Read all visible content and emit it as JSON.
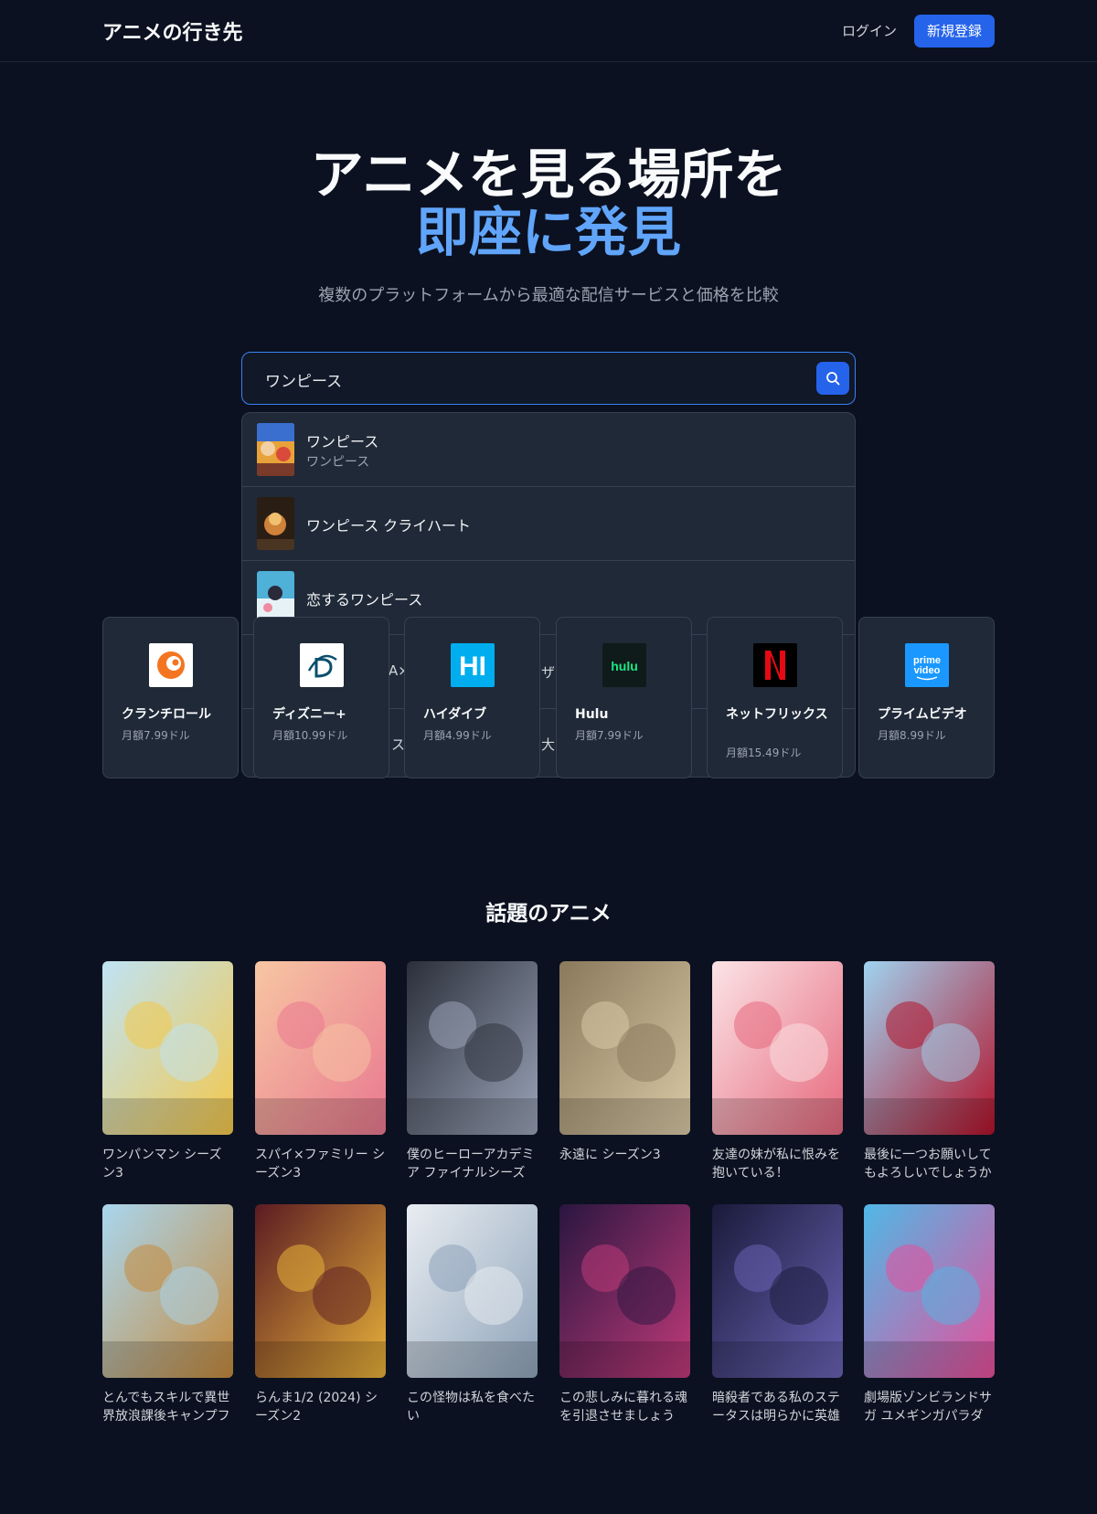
{
  "header": {
    "brand": "アニメの行き先",
    "login": "ログイン",
    "signup": "新規登録"
  },
  "hero": {
    "line1": "アニメを見る場所を",
    "line2": "即座に発見",
    "subtitle": "複数のプラットフォームから最適な配信サービスと価格を比較"
  },
  "search": {
    "value": "ワンピース",
    "results": [
      {
        "title": "ワンピース",
        "subtitle": "ワンピース"
      },
      {
        "title": "ワンピース クライハート"
      },
      {
        "title": "恋するワンピース"
      }
    ],
    "hidden_fragments": [
      "A×",
      "ザン",
      "ス",
      "大"
    ]
  },
  "services": [
    {
      "name": "クランチロール",
      "price": "月額7.99ドル",
      "logo": "crunchyroll-logo",
      "color": "#f47521"
    },
    {
      "name": "ディズニー+",
      "price": "月額10.99ドル",
      "logo": "disney-plus-logo",
      "color": "#0b4f6c"
    },
    {
      "name": "ハイダイブ",
      "price": "月額4.99ドル",
      "logo": "hidive-logo",
      "color": "#00aeef"
    },
    {
      "name": "Hulu",
      "price": "月額7.99ドル",
      "logo": "hulu-logo",
      "color": "#1ce783"
    },
    {
      "name": "ネットフリックス",
      "price": "月額15.49ドル",
      "logo": "netflix-logo",
      "color": "#e50914"
    },
    {
      "name": "プライムビデオ",
      "price": "月額8.99ドル",
      "logo": "prime-video-logo",
      "color": "#1a98ff"
    }
  ],
  "logo_text": {
    "hidive": "HI",
    "hulu": "hulu",
    "prime1": "prime",
    "prime2": "video"
  },
  "trending": {
    "title": "話題のアニメ",
    "items": [
      {
        "title": "ワンパンマン シーズン3",
        "colors": [
          "#bfe3f5",
          "#f3c84b"
        ]
      },
      {
        "title": "スパイ×ファミリー シーズン3",
        "colors": [
          "#f7c6a3",
          "#e9788f"
        ]
      },
      {
        "title": "僕のヒーローアカデミア ファイナルシーズン",
        "colors": [
          "#2b2f3a",
          "#9aa4b8"
        ]
      },
      {
        "title": "永遠に シーズン3",
        "colors": [
          "#8a7a5c",
          "#d9c9a6"
        ]
      },
      {
        "title": "友達の妹が私に恨みを抱いている！",
        "colors": [
          "#fbe4e6",
          "#e6687d"
        ]
      },
      {
        "title": "最後に一つお願いしてもよろしいでしょうか",
        "colors": [
          "#9fd3f0",
          "#b3122a"
        ]
      },
      {
        "title": "とんでもスキルで異世界放浪課後キャンプファイヤー",
        "colors": [
          "#a9d6ef",
          "#c58a3c"
        ]
      },
      {
        "title": "らんま1/2 (2024) シーズン2",
        "colors": [
          "#5b1b22",
          "#e8b23a"
        ]
      },
      {
        "title": "この怪物は私を食べたい",
        "colors": [
          "#e9edf2",
          "#8ea3b9"
        ]
      },
      {
        "title": "この悲しみに暮れる魂を引退させましょう",
        "colors": [
          "#2a1640",
          "#c03a7a"
        ]
      },
      {
        "title": "暗殺者である私のステータスは明らかに英雄よりも強い",
        "colors": [
          "#1a1a3a",
          "#6a63b5"
        ]
      },
      {
        "title": "劇場版ゾンビランドサガ ユメギンガパラダイス",
        "colors": [
          "#4fb8e6",
          "#e84f9b"
        ]
      }
    ]
  }
}
